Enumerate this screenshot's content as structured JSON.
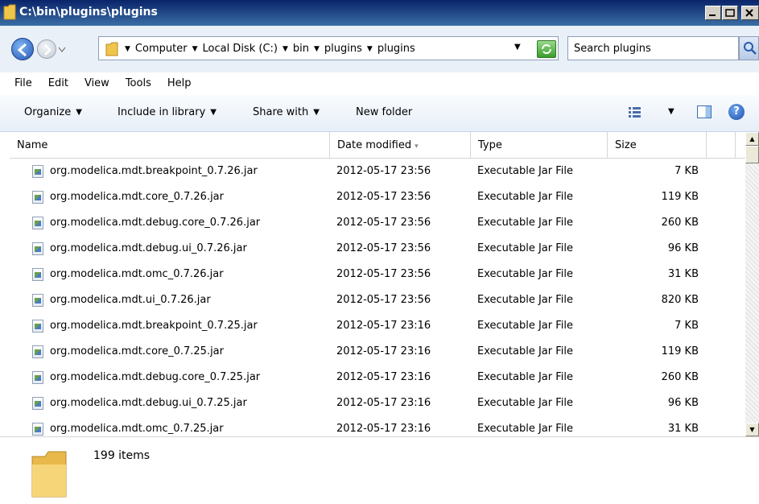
{
  "window": {
    "title": "C:\\bin\\plugins\\plugins"
  },
  "address": {
    "crumbs": [
      "Computer",
      "Local Disk (C:)",
      "bin",
      "plugins",
      "plugins"
    ],
    "search_placeholder": "Search plugins"
  },
  "menu": [
    "File",
    "Edit",
    "View",
    "Tools",
    "Help"
  ],
  "toolbar": {
    "organize": "Organize",
    "include_in_library": "Include in library",
    "share_with": "Share with",
    "new_folder": "New folder"
  },
  "columns": {
    "name": "Name",
    "date": "Date modified",
    "type": "Type",
    "size": "Size"
  },
  "files": [
    {
      "name": "org.modelica.mdt.breakpoint_0.7.26.jar",
      "date": "2012-05-17 23:56",
      "type": "Executable Jar File",
      "size": "7 KB"
    },
    {
      "name": "org.modelica.mdt.core_0.7.26.jar",
      "date": "2012-05-17 23:56",
      "type": "Executable Jar File",
      "size": "119 KB"
    },
    {
      "name": "org.modelica.mdt.debug.core_0.7.26.jar",
      "date": "2012-05-17 23:56",
      "type": "Executable Jar File",
      "size": "260 KB"
    },
    {
      "name": "org.modelica.mdt.debug.ui_0.7.26.jar",
      "date": "2012-05-17 23:56",
      "type": "Executable Jar File",
      "size": "96 KB"
    },
    {
      "name": "org.modelica.mdt.omc_0.7.26.jar",
      "date": "2012-05-17 23:56",
      "type": "Executable Jar File",
      "size": "31 KB"
    },
    {
      "name": "org.modelica.mdt.ui_0.7.26.jar",
      "date": "2012-05-17 23:56",
      "type": "Executable Jar File",
      "size": "820 KB"
    },
    {
      "name": "org.modelica.mdt.breakpoint_0.7.25.jar",
      "date": "2012-05-17 23:16",
      "type": "Executable Jar File",
      "size": "7 KB"
    },
    {
      "name": "org.modelica.mdt.core_0.7.25.jar",
      "date": "2012-05-17 23:16",
      "type": "Executable Jar File",
      "size": "119 KB"
    },
    {
      "name": "org.modelica.mdt.debug.core_0.7.25.jar",
      "date": "2012-05-17 23:16",
      "type": "Executable Jar File",
      "size": "260 KB"
    },
    {
      "name": "org.modelica.mdt.debug.ui_0.7.25.jar",
      "date": "2012-05-17 23:16",
      "type": "Executable Jar File",
      "size": "96 KB"
    },
    {
      "name": "org.modelica.mdt.omc_0.7.25.jar",
      "date": "2012-05-17 23:16",
      "type": "Executable Jar File",
      "size": "31 KB"
    }
  ],
  "status": {
    "items_count": "199 items"
  },
  "icons": {
    "title_folder": "folder-icon",
    "back": "back-arrow-icon",
    "forward": "forward-arrow-icon",
    "refresh": "refresh-icon",
    "search": "search-icon",
    "views": "views-icon",
    "preview": "preview-pane-icon",
    "help": "help-icon",
    "jar": "jar-file-icon"
  },
  "colors": {
    "titlebar": "#0a246a",
    "navbar": "#eaf0f8"
  }
}
